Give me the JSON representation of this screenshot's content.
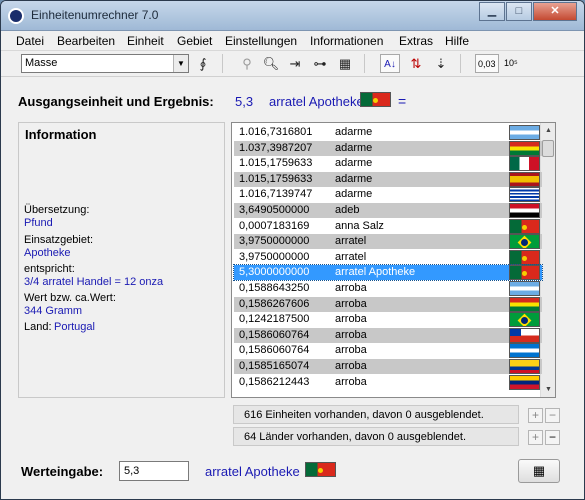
{
  "window": {
    "title": "Einheitenumrechner 7.0"
  },
  "menu": [
    "Datei",
    "Bearbeiten",
    "Einheit",
    "Gebiet",
    "Einstellungen",
    "Informationen",
    "Extras",
    "Hilfe"
  ],
  "toolbar": {
    "category": "Masse",
    "precision_label": "0,03",
    "exponent_label": "10⁵"
  },
  "result": {
    "label": "Ausgangseinheit und Ergebnis:",
    "value": "5,3",
    "unit": "arratel Apotheke",
    "equals": "=",
    "flag": "Portugal"
  },
  "info": {
    "title": "Information",
    "translation_label": "Übersetzung:",
    "translation_value": "Pfund",
    "usage_label": "Einsatzgebiet:",
    "usage_value": "Apotheke",
    "equivalent_label": "entspricht:",
    "equivalent_value": "3/4 arratel Handel = 12 onza",
    "approx_label": "Wert bzw. ca.Wert:",
    "approx_value": "344 Gramm",
    "country_label": "Land:",
    "country_value": "Portugal"
  },
  "list": {
    "rows": [
      {
        "value": "1.016,7316801",
        "unit": "adarme",
        "flag": "ar",
        "shaded": false,
        "selected": false
      },
      {
        "value": "1.037,3987207",
        "unit": "adarme",
        "flag": "bo",
        "shaded": true,
        "selected": false
      },
      {
        "value": "1.015,1759633",
        "unit": "adarme",
        "flag": "mx",
        "shaded": false,
        "selected": false
      },
      {
        "value": "1.015,1759633",
        "unit": "adarme",
        "flag": "es",
        "shaded": true,
        "selected": false
      },
      {
        "value": "1.016,7139747",
        "unit": "adarme",
        "flag": "uy",
        "shaded": false,
        "selected": false
      },
      {
        "value": "3,6490500000",
        "unit": "adeb",
        "flag": "eg",
        "shaded": true,
        "selected": false
      },
      {
        "value": "0,0007183169",
        "unit": "anna Salz",
        "flag": "pt",
        "shaded": false,
        "selected": false
      },
      {
        "value": "3,9750000000",
        "unit": "arratel",
        "flag": "br",
        "shaded": true,
        "selected": false
      },
      {
        "value": "3,9750000000",
        "unit": "arratel",
        "flag": "pt",
        "shaded": false,
        "selected": false
      },
      {
        "value": "5,3000000000",
        "unit": "arratel Apotheke",
        "flag": "pt",
        "shaded": false,
        "selected": true
      },
      {
        "value": "0,1588643250",
        "unit": "arroba",
        "flag": "ar",
        "shaded": false,
        "selected": false
      },
      {
        "value": "0,1586267606",
        "unit": "arroba",
        "flag": "bo",
        "shaded": true,
        "selected": false
      },
      {
        "value": "0,1242187500",
        "unit": "arroba",
        "flag": "br",
        "shaded": false,
        "selected": false
      },
      {
        "value": "0,1586060764",
        "unit": "arroba",
        "flag": "cl",
        "shaded": true,
        "selected": false
      },
      {
        "value": "0,1586060764",
        "unit": "arroba",
        "flag": "hn",
        "shaded": false,
        "selected": false
      },
      {
        "value": "0,1585165074",
        "unit": "arroba",
        "flag": "co",
        "shaded": true,
        "selected": false
      },
      {
        "value": "0,1586212443",
        "unit": "arroba",
        "flag": "ve",
        "shaded": false,
        "selected": false
      }
    ]
  },
  "status": {
    "units_text": "616 Einheiten vorhanden, davon 0 ausgeblendet.",
    "countries_text": "64 Länder vorhanden, davon 0 ausgeblendet.",
    "plus": "+",
    "minus": "−"
  },
  "input": {
    "label": "Werteingabe:",
    "value": "5,3",
    "unit": "arratel Apotheke",
    "flag": "Portugal"
  }
}
